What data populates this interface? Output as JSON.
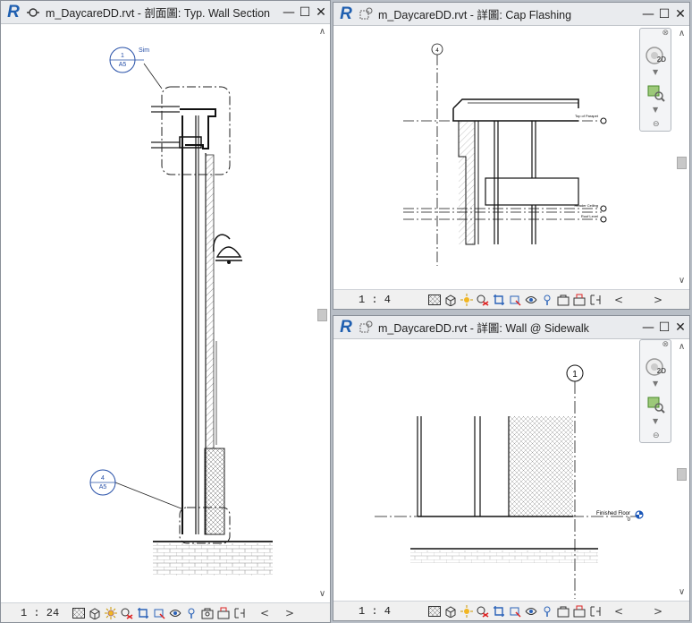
{
  "windows": [
    {
      "id": "section",
      "title": "m_DaycareDD.rvt - 剖面圖: Typ. Wall Section",
      "scale": "1 : 24",
      "tags": [
        {
          "top": "1",
          "bottom": "A5",
          "label": "Sim"
        },
        {
          "top": "4",
          "bottom": "A5",
          "label": ""
        }
      ]
    },
    {
      "id": "cap",
      "title": "m_DaycareDD.rvt - 詳圖: Cap Flashing",
      "scale": "1 : 4",
      "grid": "4",
      "levels": [
        "Top of Parapet",
        "Header Ceiling",
        "Roof Level"
      ]
    },
    {
      "id": "sidewalk",
      "title": "m_DaycareDD.rvt - 詳圖: Wall @ Sidewalk",
      "scale": "1 : 4",
      "grid": "1",
      "level_label": "Finished Floor",
      "level_value": "0"
    }
  ],
  "controls": {
    "minimize": "—",
    "maximize": "☐",
    "close": "✕",
    "scroll_up": "∧",
    "scroll_down": "∨",
    "scroll_left": "<",
    "scroll_right": ">",
    "nav_close": "⊗",
    "nav_2d": "2D"
  },
  "view_control_icons": [
    "detail-level-icon",
    "visual-style-icon",
    "sun-path-icon",
    "shadows-icon",
    "crop-view-icon",
    "show-crop-icon",
    "temporary-hide-icon",
    "reveal-hidden-icon",
    "temporary-properties-icon",
    "analytical-model-icon",
    "highlight-displacement-icon",
    "constraints-icon"
  ]
}
